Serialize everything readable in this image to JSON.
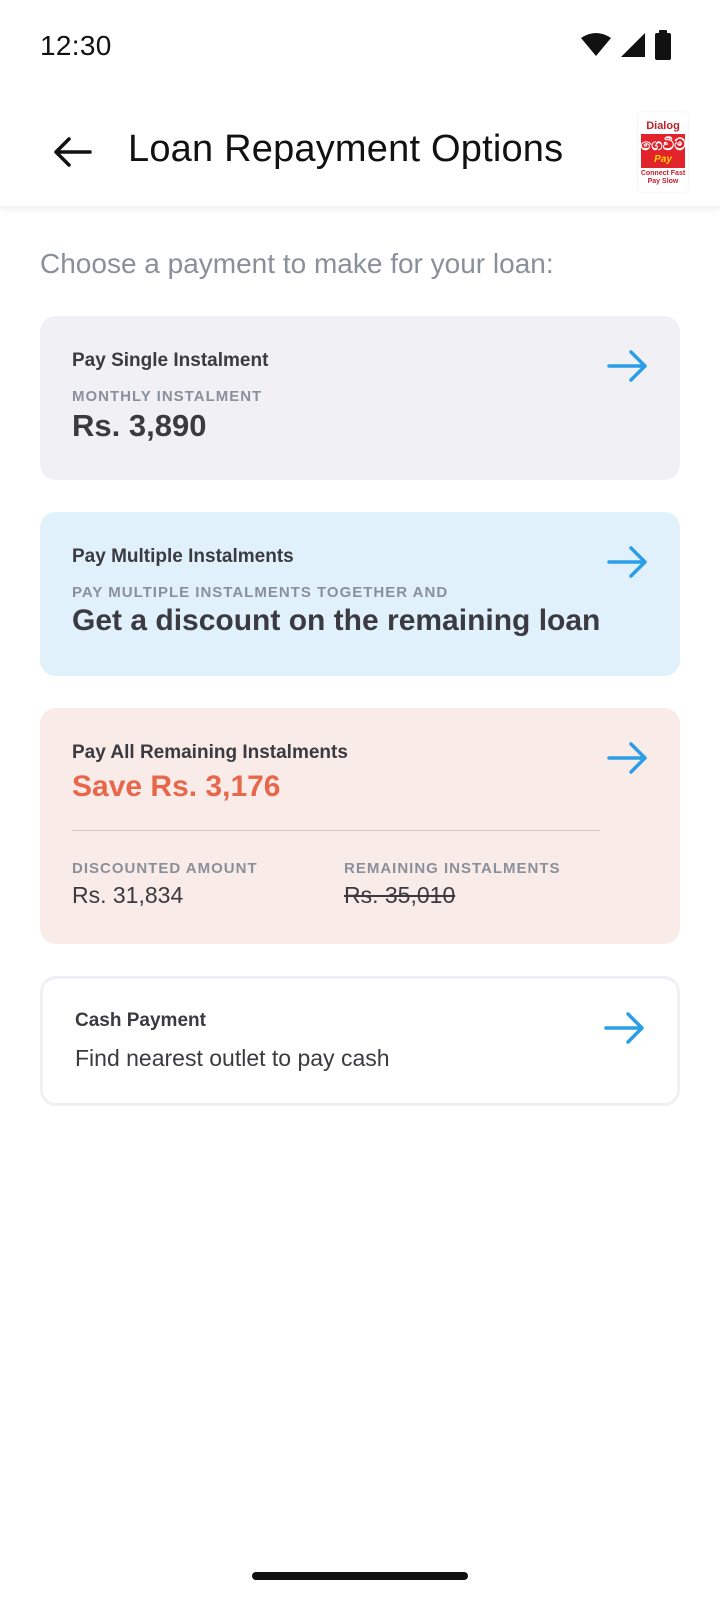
{
  "status_bar": {
    "time": "12:30",
    "icons": [
      "wifi-icon",
      "cellular-signal-icon",
      "battery-icon"
    ]
  },
  "app_bar": {
    "back_icon": "arrow-left-icon",
    "title": "Loan Repayment Options",
    "logo": {
      "brand": "Dialog",
      "mark": "ගෙවීම්",
      "product": "Pay",
      "tagline_1": "Connect Fast",
      "tagline_2": "Pay Slow"
    }
  },
  "intro_text": "Choose a payment to make for your loan:",
  "options": {
    "single": {
      "heading": "Pay Single Instalment",
      "caption": "MONTHLY INSTALMENT",
      "value": "Rs. 3,890",
      "background": "#f1f1f5"
    },
    "multiple": {
      "heading": "Pay Multiple Instalments",
      "caption": "PAY MULTIPLE INSTALMENTS TOGETHER AND",
      "value": "Get a discount on the remaining loan",
      "background": "#e1f1fc"
    },
    "all_remaining": {
      "heading": "Pay All Remaining Instalments",
      "savings": "Save Rs. 3,176",
      "discounted_label": "DISCOUNTED AMOUNT",
      "discounted_value": "Rs. 31,834",
      "remaining_label": "REMAINING INSTALMENTS",
      "remaining_value": "Rs. 35,010",
      "background": "#f9ece8"
    },
    "cash": {
      "heading": "Cash Payment",
      "description": "Find nearest outlet to pay cash",
      "background": "#ffffff"
    }
  },
  "colors": {
    "accent_arrow": "#2a9ee6",
    "savings_text": "#e8674a",
    "muted_text": "#8a8f9c"
  }
}
